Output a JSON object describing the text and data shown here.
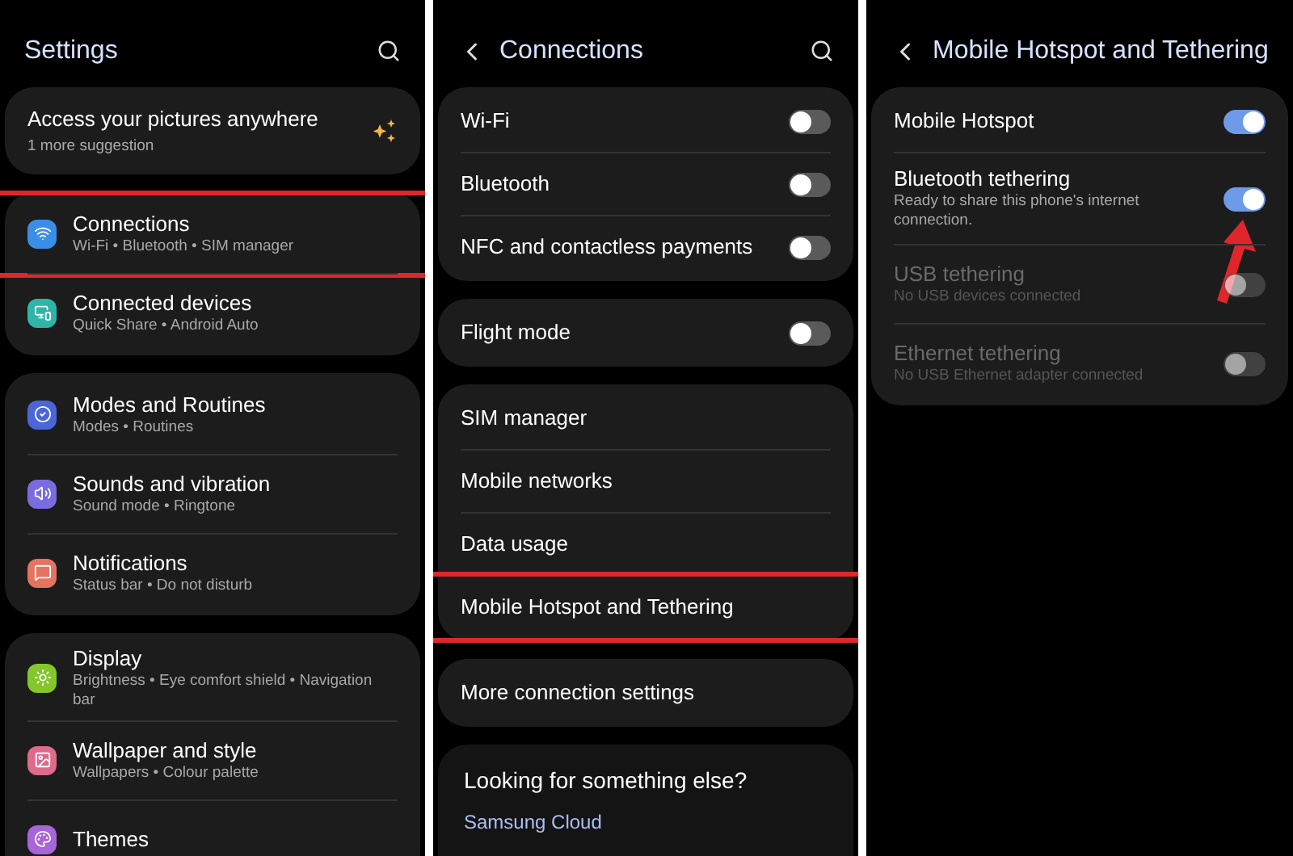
{
  "screens": [
    {
      "title": "Settings",
      "kind": "root",
      "groups": [
        {
          "kind": "suggestion",
          "title": "Access your pictures anywhere",
          "sub": "1 more suggestion"
        },
        {
          "kind": "list",
          "items": [
            {
              "label": "Connections",
              "sub": "Wi-Fi  •  Bluetooth  •  SIM manager",
              "color": "#3b8ee6",
              "highlighted": true
            },
            {
              "label": "Connected devices",
              "sub": "Quick Share  •  Android Auto",
              "color": "#2fb5a8",
              "highlighted": false
            }
          ]
        },
        {
          "kind": "list",
          "items": [
            {
              "label": "Modes and Routines",
              "sub": "Modes  •  Routines",
              "color": "#4a66d9",
              "highlighted": false
            },
            {
              "label": "Sounds and vibration",
              "sub": "Sound mode  •  Ringtone",
              "color": "#7b6be0",
              "highlighted": false
            },
            {
              "label": "Notifications",
              "sub": "Status bar  •  Do not disturb",
              "color": "#e5735f",
              "highlighted": false
            }
          ]
        },
        {
          "kind": "list",
          "items": [
            {
              "label": "Display",
              "sub": "Brightness  •  Eye comfort shield  •  Navigation bar",
              "color": "#84c62b",
              "highlighted": false
            },
            {
              "label": "Wallpaper and style",
              "sub": "Wallpapers  •  Colour palette",
              "color": "#de6a8c",
              "highlighted": false
            },
            {
              "label": "Themes",
              "color": "#a765d8",
              "highlighted": false
            }
          ]
        }
      ]
    },
    {
      "title": "Connections",
      "kind": "page",
      "groups": [
        {
          "kind": "list",
          "items": [
            {
              "label": "Wi-Fi",
              "on": false,
              "highlighted": false
            },
            {
              "label": "Bluetooth",
              "on": false,
              "highlighted": false
            },
            {
              "label": "NFC and contactless payments",
              "on": false,
              "highlighted": false
            }
          ]
        },
        {
          "kind": "list",
          "items": [
            {
              "label": "Flight mode",
              "on": false,
              "highlighted": false
            }
          ]
        },
        {
          "kind": "list",
          "items": [
            {
              "label": "SIM manager",
              "highlighted": false
            },
            {
              "label": "Mobile networks",
              "highlighted": false
            },
            {
              "label": "Data usage",
              "highlighted": false
            },
            {
              "label": "Mobile Hotspot and Tethering",
              "highlighted": true
            }
          ]
        },
        {
          "kind": "list",
          "items": [
            {
              "label": "More connection settings",
              "highlighted": false
            }
          ]
        },
        {
          "kind": "links",
          "title": "Looking for something else?",
          "links": [
            "Samsung Cloud"
          ]
        }
      ]
    },
    {
      "title": "Mobile Hotspot and Tethering",
      "kind": "detail",
      "groups": [
        {
          "kind": "list",
          "items": [
            {
              "label": "Mobile Hotspot",
              "on": true,
              "disabled": false,
              "highlighted": false
            },
            {
              "label": "Bluetooth tethering",
              "sub": "Ready to share this phone's internet connection.",
              "on": true,
              "disabled": false,
              "highlighted": false,
              "pointer": true
            },
            {
              "label": "USB tethering",
              "sub": "No USB devices connected",
              "on": false,
              "disabled": true,
              "highlighted": false
            },
            {
              "label": "Ethernet tethering",
              "sub": "No USB Ethernet adapter connected",
              "on": false,
              "disabled": true,
              "highlighted": false
            }
          ]
        }
      ]
    }
  ]
}
